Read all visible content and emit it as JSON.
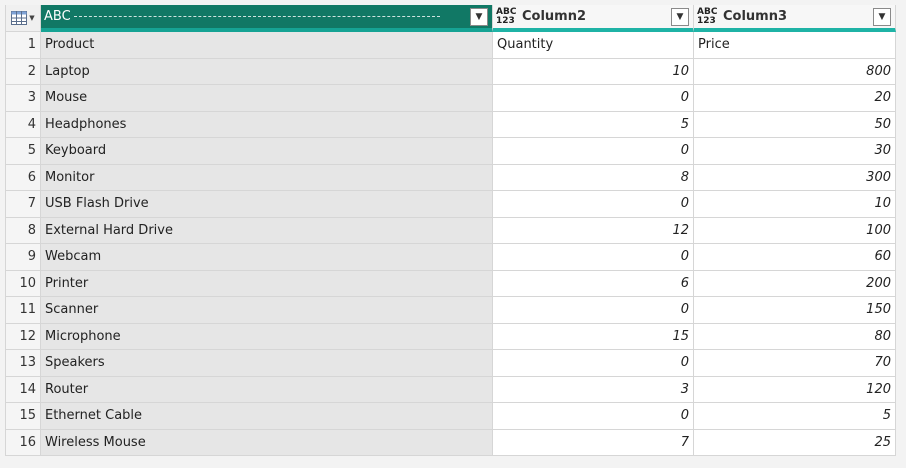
{
  "header": {
    "col1_type": "ABC",
    "col2_type_top": "ABC",
    "col2_type_bottom": "123",
    "col2_name": "Column2",
    "col3_type_top": "ABC",
    "col3_type_bottom": "123",
    "col3_name": "Column3"
  },
  "rows": [
    {
      "num": "1",
      "product": "Product",
      "qty": "Quantity",
      "price": "Price"
    },
    {
      "num": "2",
      "product": "Laptop",
      "qty": "10",
      "price": "800"
    },
    {
      "num": "3",
      "product": "Mouse",
      "qty": "0",
      "price": "20"
    },
    {
      "num": "4",
      "product": "Headphones",
      "qty": "5",
      "price": "50"
    },
    {
      "num": "5",
      "product": "Keyboard",
      "qty": "0",
      "price": "30"
    },
    {
      "num": "6",
      "product": "Monitor",
      "qty": "8",
      "price": "300"
    },
    {
      "num": "7",
      "product": "USB Flash Drive",
      "qty": "0",
      "price": "10"
    },
    {
      "num": "8",
      "product": "External Hard Drive",
      "qty": "12",
      "price": "100"
    },
    {
      "num": "9",
      "product": "Webcam",
      "qty": "0",
      "price": "60"
    },
    {
      "num": "10",
      "product": "Printer",
      "qty": "6",
      "price": "200"
    },
    {
      "num": "11",
      "product": "Scanner",
      "qty": "0",
      "price": "150"
    },
    {
      "num": "12",
      "product": "Microphone",
      "qty": "15",
      "price": "80"
    },
    {
      "num": "13",
      "product": "Speakers",
      "qty": "0",
      "price": "70"
    },
    {
      "num": "14",
      "product": "Router",
      "qty": "3",
      "price": "120"
    },
    {
      "num": "15",
      "product": "Ethernet Cable",
      "qty": "0",
      "price": "5"
    },
    {
      "num": "16",
      "product": "Wireless Mouse",
      "qty": "7",
      "price": "25"
    }
  ],
  "colors": {
    "selected_header": "#117865",
    "accent_underline": "#1fb3a6",
    "selected_column_fill": "#e6e6e6"
  }
}
